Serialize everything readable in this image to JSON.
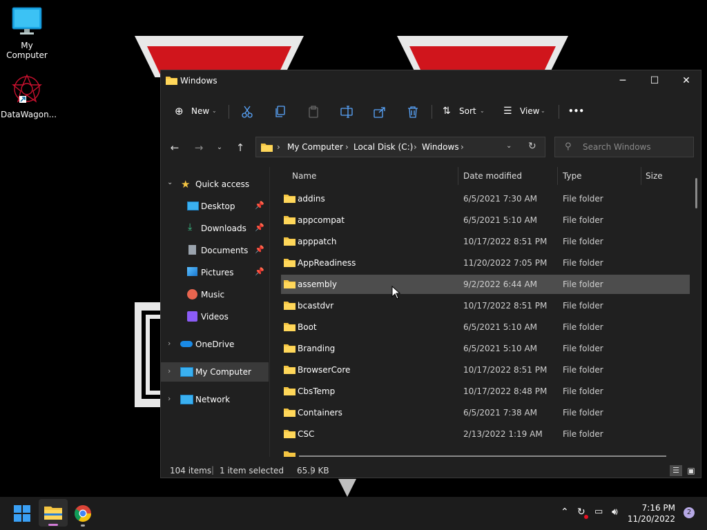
{
  "desktop": {
    "icons": [
      {
        "label": "My Computer",
        "icon": "monitor-icon"
      },
      {
        "label": "DataWagon...",
        "icon": "datawagon-app-icon"
      }
    ]
  },
  "window": {
    "title": "Windows",
    "controls": {
      "minimize": "─",
      "maximize": "☐",
      "close": "✕"
    }
  },
  "toolbar": {
    "new_label": "New",
    "sort_label": "Sort",
    "view_label": "View",
    "more_label": "•••"
  },
  "address": {
    "crumbs": [
      "My Computer",
      "Local Disk (C:)",
      "Windows"
    ],
    "search_placeholder": "Search Windows"
  },
  "sidebar": {
    "quick_access": "Quick access",
    "pinned": [
      {
        "label": "Desktop",
        "pinned": true
      },
      {
        "label": "Downloads",
        "pinned": true
      },
      {
        "label": "Documents",
        "pinned": true
      },
      {
        "label": "Pictures",
        "pinned": true
      },
      {
        "label": "Music",
        "pinned": false
      },
      {
        "label": "Videos",
        "pinned": false
      }
    ],
    "onedrive": "OneDrive",
    "my_computer": "My Computer",
    "network": "Network"
  },
  "columns": {
    "name": "Name",
    "date": "Date modified",
    "type": "Type",
    "size": "Size"
  },
  "files": [
    {
      "name": "addins",
      "date": "6/5/2021 7:30 AM",
      "type": "File folder"
    },
    {
      "name": "appcompat",
      "date": "6/5/2021 5:10 AM",
      "type": "File folder"
    },
    {
      "name": "apppatch",
      "date": "10/17/2022 8:51 PM",
      "type": "File folder"
    },
    {
      "name": "AppReadiness",
      "date": "11/20/2022 7:05 PM",
      "type": "File folder"
    },
    {
      "name": "assembly",
      "date": "9/2/2022 6:44 AM",
      "type": "File folder"
    },
    {
      "name": "bcastdvr",
      "date": "10/17/2022 8:51 PM",
      "type": "File folder"
    },
    {
      "name": "Boot",
      "date": "6/5/2021 5:10 AM",
      "type": "File folder"
    },
    {
      "name": "Branding",
      "date": "6/5/2021 5:10 AM",
      "type": "File folder"
    },
    {
      "name": "BrowserCore",
      "date": "10/17/2022 8:51 PM",
      "type": "File folder"
    },
    {
      "name": "CbsTemp",
      "date": "10/17/2022 8:48 PM",
      "type": "File folder"
    },
    {
      "name": "Containers",
      "date": "6/5/2021 7:38 AM",
      "type": "File folder"
    },
    {
      "name": "CSC",
      "date": "2/13/2022 1:19 AM",
      "type": "File folder"
    }
  ],
  "status": {
    "items": "104 items",
    "selected": "1 item selected",
    "size": "65.9 KB"
  },
  "taskbar": {
    "time": "7:16 PM",
    "date": "11/20/2022",
    "notifications": "2"
  },
  "colors": {
    "folder": "#f4c542",
    "accent": "#0078d4",
    "selected_row": "#4d4d4d"
  }
}
